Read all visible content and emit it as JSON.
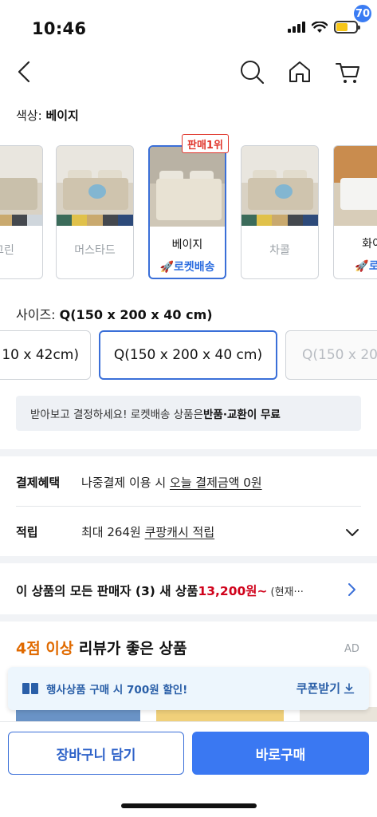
{
  "status_bar": {
    "time": "10:46"
  },
  "nav": {
    "cart_count": "70"
  },
  "color_option": {
    "label": "색상: ",
    "selected": "베이지"
  },
  "swatches": [
    {
      "name": "그린",
      "selected": false
    },
    {
      "name": "머스타드",
      "selected": false
    },
    {
      "name": "베이지",
      "selected": true,
      "badge": "판매1위",
      "delivery": "🚀로켓배송"
    },
    {
      "name": "차콜",
      "selected": false
    },
    {
      "name": "화이",
      "selected": false,
      "delivery": "🚀로켓"
    }
  ],
  "size_option": {
    "label": "사이즈: ",
    "selected": "Q(150 x 200 x 40 cm)",
    "chips": [
      "10 x 42cm)",
      "Q(150 x 200 x 40 cm)",
      "Q(150 x 20"
    ]
  },
  "notice": {
    "prefix": "받아보고 결정하세요! 로켓배송 상품은 ",
    "bold": "반품·교환이 무료"
  },
  "payment_benefit": {
    "key": "결제혜택",
    "text": "나중결제 이용 시 ",
    "link": "오늘 결제금액 0원"
  },
  "points": {
    "key": "적립",
    "text": "최대 264원 ",
    "link": "쿠팡캐시 적립"
  },
  "sellers": {
    "text": "이 상품의 모든 판매자 (3) 새 상품 ",
    "price": "13,200원~",
    "more": "(현재···"
  },
  "recommend": {
    "highlight": "4점 이상",
    "title": " 리뷰가 좋은 상품",
    "ad": "AD"
  },
  "coupon": {
    "text": "행사상품 구매 시 700원 할인!",
    "cta": "쿠폰받기"
  },
  "actions": {
    "cart": "장바구니 담기",
    "buy": "바로구매"
  },
  "colors": {
    "accent": "#3a78f2",
    "price": "#d0021b",
    "badge": "#e0352b",
    "highlight": "#e06a00"
  }
}
